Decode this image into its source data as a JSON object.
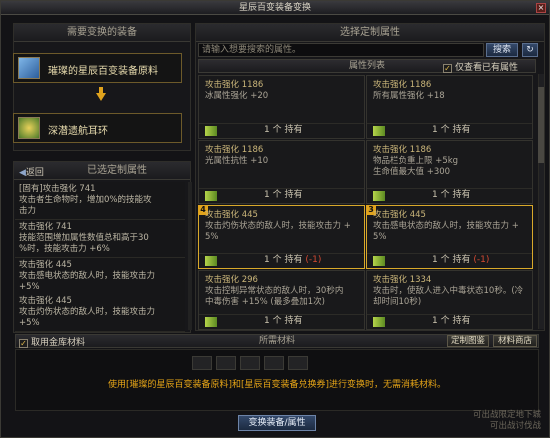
{
  "window": {
    "title": "星辰百变装备变换"
  },
  "left": {
    "head_equip": "需要变换的装备",
    "material_name": "璀璨的星辰百变装备原料",
    "target_name": "深潜遗航耳环",
    "back_label": "返回",
    "head_selected": "已选定制属性",
    "selected": [
      {
        "lines": [
          "[固有]攻击强化 741",
          "攻击者生命物时，增加0%的技能攻",
          "击力"
        ]
      },
      {
        "lines": [
          "攻击强化 741",
          "技能范围增加属性数值总和高于30",
          "%时，技能攻击力 +6%"
        ]
      },
      {
        "lines": [
          "攻击强化 445",
          "攻击感电状态的敌人时，技能攻击力",
          "+5%"
        ]
      },
      {
        "lines": [
          "攻击强化 445",
          "攻击灼伤状态的敌人时，技能攻击力",
          "+5%"
        ]
      }
    ]
  },
  "right": {
    "head": "选择定制属性",
    "search_placeholder": "请输入想要搜索的属性。",
    "search_label": "搜索",
    "refresh_icon": "↻",
    "list_head": "属性列表",
    "only_show_label": "仅查看已有属性",
    "only_show_check": "✓",
    "cards": [
      {
        "num": "",
        "selected": false,
        "lines": [
          "攻击强化 1186",
          "冰属性强化 +20"
        ],
        "count": "1 个 持有",
        "warn": ""
      },
      {
        "num": "",
        "selected": false,
        "lines": [
          "攻击强化 1186",
          "所有属性强化 +18"
        ],
        "count": "1 个 持有",
        "warn": ""
      },
      {
        "num": "",
        "selected": false,
        "lines": [
          "攻击强化 1186",
          "光属性抗性 +10"
        ],
        "count": "1 个 持有",
        "warn": ""
      },
      {
        "num": "",
        "selected": false,
        "lines": [
          "攻击强化 1186",
          "物品栏负重上限 +5kg",
          "生命值最大值 +300"
        ],
        "count": "1 个 持有",
        "warn": ""
      },
      {
        "num": "4",
        "selected": true,
        "lines": [
          "攻击强化 445",
          "攻击灼伤状态的敌人时，技能攻击力 +",
          "5%"
        ],
        "count": "1 个 持有",
        "warn": "(-1)"
      },
      {
        "num": "3",
        "selected": true,
        "lines": [
          "攻击强化 445",
          "攻击感电状态的敌人时，技能攻击力 +",
          "5%"
        ],
        "count": "1 个 持有",
        "warn": "(-1)"
      },
      {
        "num": "",
        "selected": false,
        "lines": [
          "攻击强化 296",
          "攻击控制异常状态的敌人时，30秒内",
          "中毒伤害 +15% (最多叠加1次)"
        ],
        "count": "1 个 持有",
        "warn": ""
      },
      {
        "num": "",
        "selected": false,
        "lines": [
          "攻击强化 1334",
          "攻击时，使敌人进入中毒状态10秒。(冷",
          "却时间10秒)"
        ],
        "count": "1 个 持有",
        "warn": ""
      }
    ]
  },
  "bottom": {
    "use_gold_label": "取用金库材料",
    "use_gold_check": "✓",
    "materials_head": "所需材料",
    "customize_preview_label": "定制图鉴",
    "material_shop_label": "材料商店",
    "notice": "使用[璀璨的星辰百变装备原料]和[星辰百变装备兑换券]进行变换时，无需消耗材料。",
    "corner_line1": "可出战限定地下城",
    "corner_line2": "可出战讨伐战",
    "exchange_label": "变换装备/属性"
  },
  "colors": {
    "accent_gold": "#e0a31d",
    "warn_red": "#d44a33",
    "notice_orange": "#e5a417"
  }
}
